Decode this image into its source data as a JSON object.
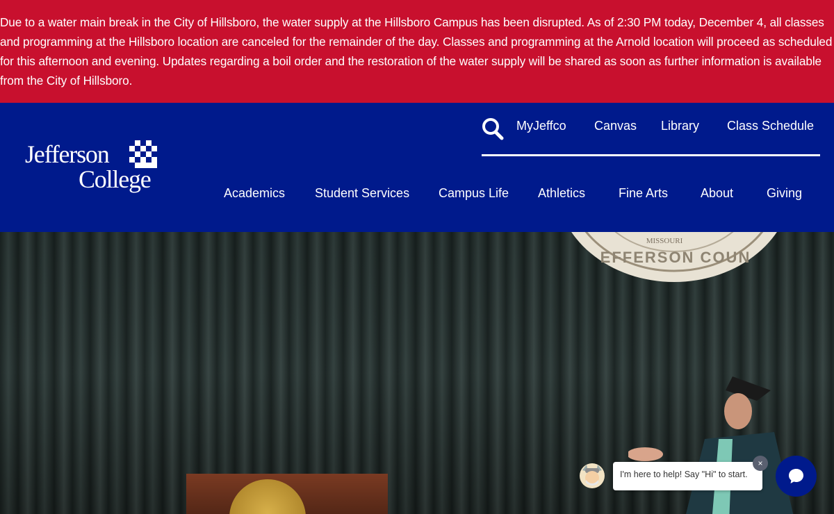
{
  "alert": {
    "message": "Due to a water main break in the City of Hillsboro, the water supply at the Hillsboro Campus has been disrupted. As of 2:30 PM today, December 4, all classes and programming at the Hillsboro location are canceled for the remainder of the day. Classes and programming at the Arnold location will proceed as scheduled for this afternoon and evening. Updates regarding a boil order and the restoration of the water supply will be shared as soon as further information is available from the City of Hillsboro."
  },
  "colors": {
    "alert_bg": "#c8102e",
    "brand_blue": "#001a8c",
    "text": "#ffffff"
  },
  "logo": {
    "line1": "Jefferson",
    "line2": "College"
  },
  "utility_nav": {
    "search_icon": "search-icon",
    "links": [
      "MyJeffco",
      "Canvas",
      "Library",
      "Class Schedule"
    ]
  },
  "main_nav": [
    "Academics",
    "Student Services",
    "Campus Life",
    "Athletics",
    "Fine Arts",
    "About",
    "Giving"
  ],
  "hero": {
    "seal_text": "EFFERSON COUN",
    "seal_small": "MISSOURI"
  },
  "chat": {
    "greeting": "I'm here to help! Say \"Hi\" to start.",
    "close": "×",
    "icon": "chat-bubble-icon"
  }
}
